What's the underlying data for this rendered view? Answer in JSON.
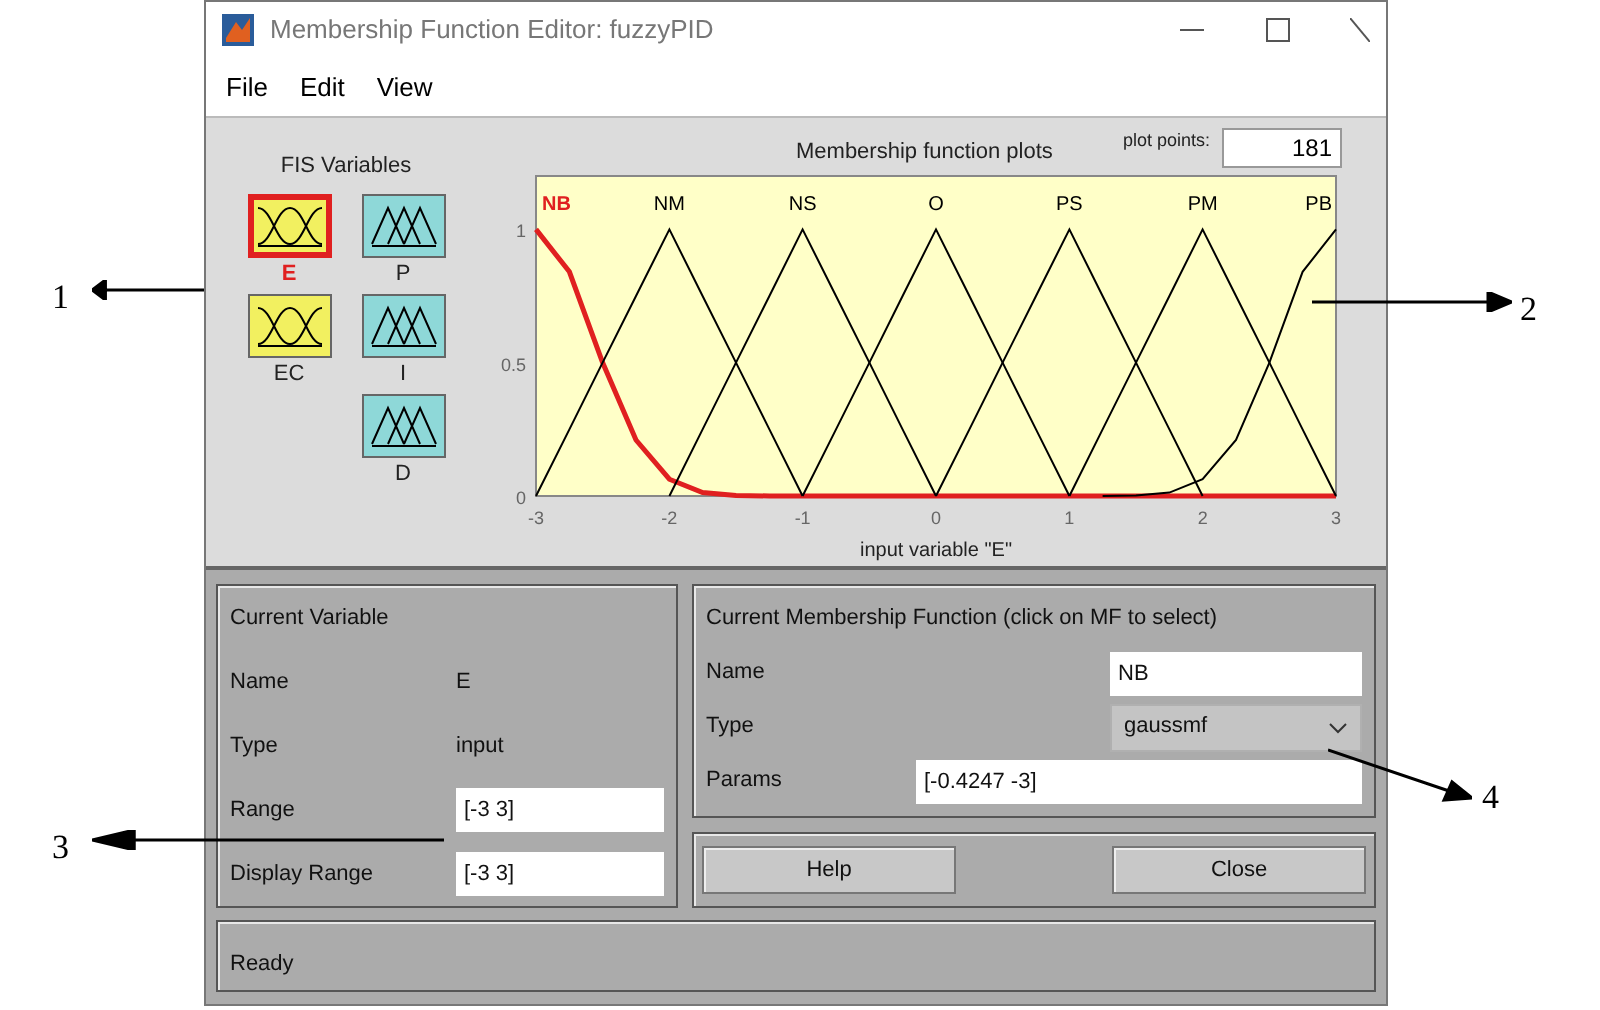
{
  "window": {
    "title": "Membership Function Editor: fuzzyPID"
  },
  "menu": [
    "File",
    "Edit",
    "View"
  ],
  "fis_variables": {
    "title": "FIS Variables",
    "columns": [
      [
        {
          "name": "E",
          "kind": "input",
          "selected": true
        },
        {
          "name": "EC",
          "kind": "input",
          "selected": false
        }
      ],
      [
        {
          "name": "P",
          "kind": "output",
          "selected": false
        },
        {
          "name": "I",
          "kind": "output",
          "selected": false
        },
        {
          "name": "D",
          "kind": "output",
          "selected": false
        }
      ]
    ]
  },
  "plot_points": {
    "label": "plot points:",
    "value": "181"
  },
  "chart_data": {
    "type": "line",
    "title": "Membership function plots",
    "xlabel": "input variable \"E\"",
    "xlim": [
      -3,
      3
    ],
    "ylim": [
      0,
      1.2
    ],
    "xticks": [
      -3,
      -2,
      -1,
      0,
      1,
      2,
      3
    ],
    "yticks": [
      0,
      0.5,
      1
    ],
    "x": [
      -3,
      -2.75,
      -2.5,
      -2.25,
      -2,
      -1.75,
      -1.5,
      -1.25,
      -1,
      -0.75,
      -0.5,
      -0.25,
      0,
      0.25,
      0.5,
      0.75,
      1,
      1.25,
      1.5,
      1.75,
      2,
      2.25,
      2.5,
      2.75,
      3
    ],
    "series": [
      {
        "name": "NB",
        "color": "#e02020",
        "values": [
          1,
          0.841,
          0.5,
          0.21,
          0.063,
          0.013,
          0.002,
          0,
          0,
          0,
          0,
          0,
          0,
          0,
          0,
          0,
          0,
          0,
          0,
          0,
          0,
          0,
          0,
          0,
          0
        ]
      },
      {
        "name": "NM",
        "color": "#000000",
        "values": [
          0,
          0.25,
          0.5,
          0.75,
          1,
          0.75,
          0.5,
          0.25,
          0,
          null,
          null,
          null,
          null,
          null,
          null,
          null,
          null,
          null,
          null,
          null,
          null,
          null,
          null,
          null,
          null
        ]
      },
      {
        "name": "NS",
        "color": "#000000",
        "values": [
          null,
          null,
          null,
          null,
          0,
          0.25,
          0.5,
          0.75,
          1,
          0.75,
          0.5,
          0.25,
          0,
          null,
          null,
          null,
          null,
          null,
          null,
          null,
          null,
          null,
          null,
          null,
          null
        ]
      },
      {
        "name": "O",
        "color": "#000000",
        "values": [
          null,
          null,
          null,
          null,
          null,
          null,
          null,
          null,
          0,
          0.25,
          0.5,
          0.75,
          1,
          0.75,
          0.5,
          0.25,
          0,
          null,
          null,
          null,
          null,
          null,
          null,
          null,
          null
        ]
      },
      {
        "name": "PS",
        "color": "#000000",
        "values": [
          null,
          null,
          null,
          null,
          null,
          null,
          null,
          null,
          null,
          null,
          null,
          null,
          0,
          0.25,
          0.5,
          0.75,
          1,
          0.75,
          0.5,
          0.25,
          0,
          null,
          null,
          null,
          null
        ]
      },
      {
        "name": "PM",
        "color": "#000000",
        "values": [
          null,
          null,
          null,
          null,
          null,
          null,
          null,
          null,
          null,
          null,
          null,
          null,
          null,
          null,
          null,
          null,
          0,
          0.25,
          0.5,
          0.75,
          1,
          0.75,
          0.5,
          0.25,
          0
        ]
      },
      {
        "name": "PB",
        "color": "#000000",
        "values": [
          null,
          null,
          null,
          null,
          null,
          null,
          null,
          null,
          null,
          null,
          null,
          null,
          null,
          null,
          null,
          null,
          null,
          0,
          0.002,
          0.013,
          0.063,
          0.21,
          0.5,
          0.841,
          1
        ]
      }
    ]
  },
  "current_variable": {
    "title": "Current Variable",
    "rows": [
      {
        "label": "Name",
        "kind": "text",
        "value": "E"
      },
      {
        "label": "Type",
        "kind": "text",
        "value": "input"
      },
      {
        "label": "Range",
        "kind": "field",
        "value": "[-3 3]"
      },
      {
        "label": "Display Range",
        "kind": "field",
        "value": "[-3 3]"
      }
    ]
  },
  "current_mf": {
    "title": "Current Membership Function (click on MF to select)",
    "name": {
      "label": "Name",
      "value": "NB"
    },
    "type": {
      "label": "Type",
      "value": "gaussmf"
    },
    "params": {
      "label": "Params",
      "value": "[-0.4247 -3]"
    }
  },
  "buttons": [
    "Help",
    "Close"
  ],
  "status": "Ready",
  "annotations": [
    "1",
    "2",
    "3",
    "4"
  ]
}
